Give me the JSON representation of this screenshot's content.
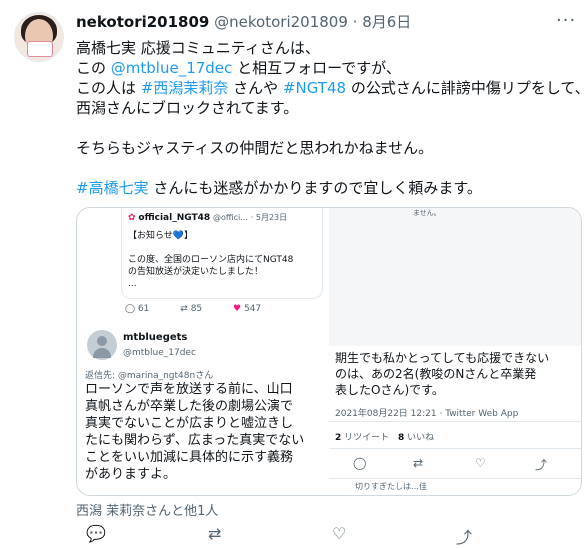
{
  "tweet": {
    "display_name": "nekotori201809",
    "handle": "@nekotori201809",
    "dot": "·",
    "date": "8月6日",
    "more_icon": "···",
    "lines": [
      {
        "parts": [
          {
            "t": "高橋七実 応援コミュニティさんは、",
            "link": false
          }
        ]
      },
      {
        "parts": [
          {
            "t": "この ",
            "link": false
          },
          {
            "t": "@mtblue_17dec",
            "link": true
          },
          {
            "t": " と相互フォローですが、",
            "link": false
          }
        ]
      },
      {
        "parts": [
          {
            "t": "この人は ",
            "link": false
          },
          {
            "t": "#西潟茉莉奈",
            "link": true
          },
          {
            "t": " さんや ",
            "link": false
          },
          {
            "t": "#NGT48",
            "link": true
          },
          {
            "t": " の公式さんに誹謗中傷リプをして、",
            "link": false
          }
        ]
      },
      {
        "parts": [
          {
            "t": "西潟さんにブロックされてます。",
            "link": false
          }
        ]
      },
      {
        "parts": []
      },
      {
        "parts": [
          {
            "t": "そちらもジャスティスの仲間だと思われかねません。",
            "link": false
          }
        ]
      },
      {
        "parts": []
      },
      {
        "parts": [
          {
            "t": "#高橋七実",
            "link": true
          },
          {
            "t": " さんにも迷惑がかかりますので宜しく頼みます。",
            "link": false
          }
        ]
      }
    ]
  },
  "card_left": {
    "quote_name": "official_NGT48",
    "quote_handle": "@offici...",
    "quote_date": "· 5月23日",
    "quote_tag": "【お知らせ💙】",
    "quote_text1": "この度、全国のローソン店内にてNGT48",
    "quote_text2": "の告知放送が決定いたしました！",
    "quote_ellipsis": "...",
    "reply_count": "61",
    "rt_count": "85",
    "like_count": "547",
    "user_name": "mtbluegets",
    "user_handle": "@mtblue_17dec",
    "reply_to": "返信先: @marina_ngt48nさん",
    "reply_lines": [
      "ローソンで声を放送する前に、山口",
      "真帆さんが卒業した後の劇場公演で",
      "真実でないことが広まりと嘘泣きし",
      "たにも関わらず、広まった真実でない",
      "ことをいい加減に具体的に示す義務",
      "がありますよ。"
    ]
  },
  "card_right": {
    "top_text": "ません。",
    "body_lines": [
      "期生でも私かとってしても応援できない",
      "のは、あの2名(教唆のNさんと卒業発",
      "表したOさん)です。"
    ],
    "meta": "2021年08月22日 12:21 · Twitter Web App",
    "retweets_num": "2",
    "retweets_label": "リツイート",
    "likes_num": "8",
    "likes_label": "いいね",
    "bottom_fragment": "切りすぎたしは…佳"
  },
  "footer": {
    "tagged": "西潟 茉莉奈さんと他1人"
  },
  "actions": {
    "reply_icon": "💬",
    "retweet_icon": "⇄",
    "like_icon": "♡",
    "share_icon": "⤴"
  }
}
